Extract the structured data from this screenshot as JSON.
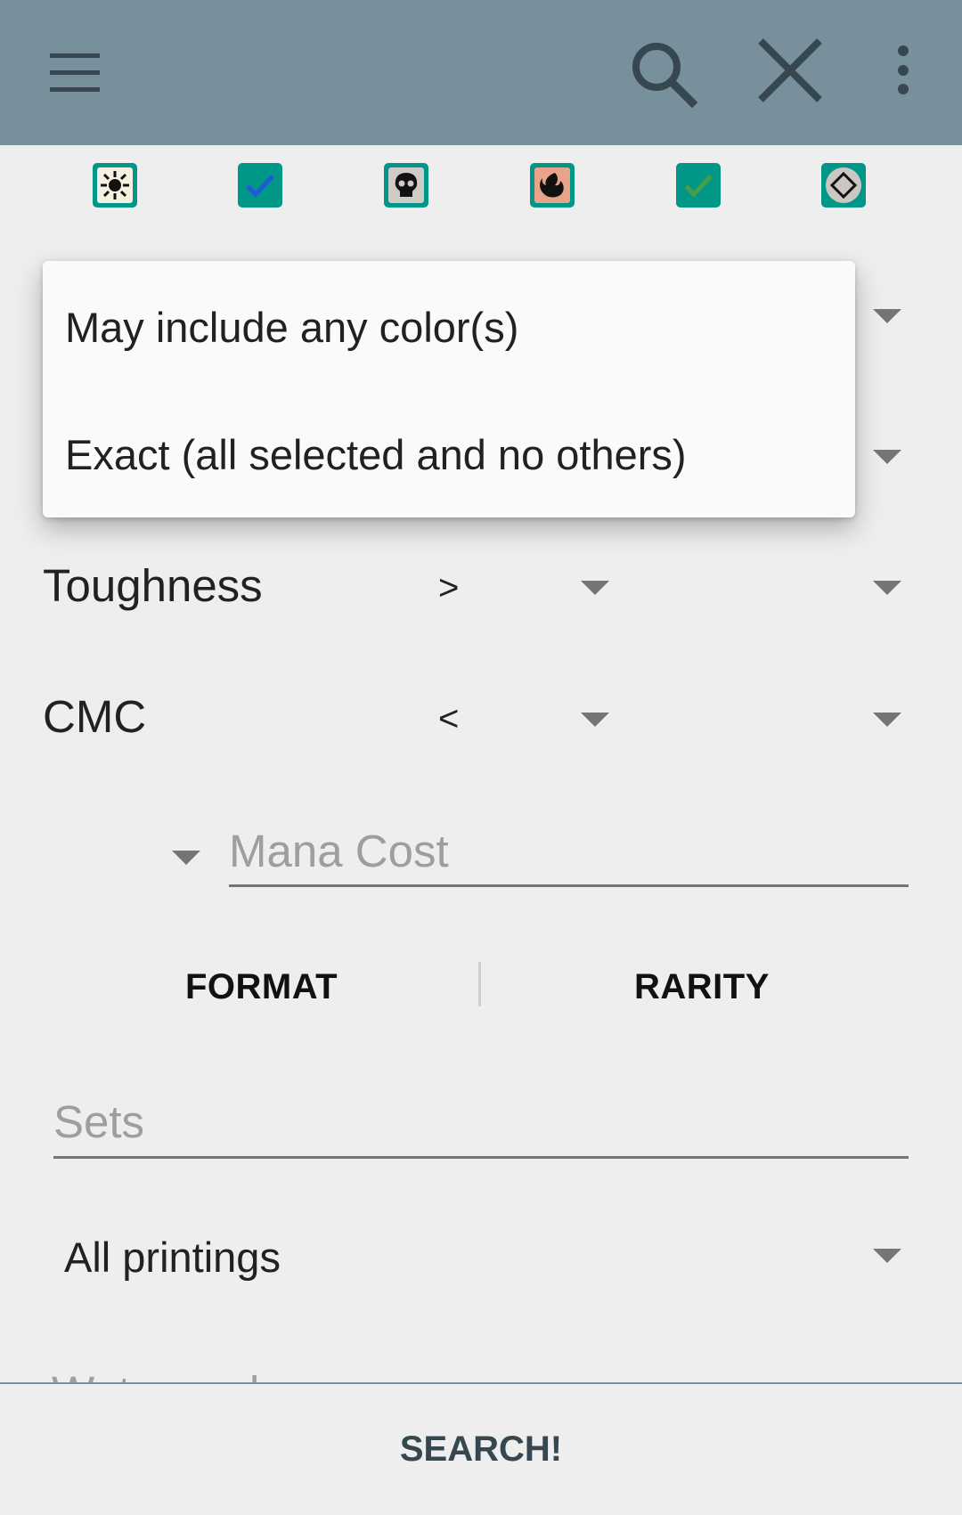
{
  "app_bar": {
    "background": "#78909c",
    "icons": [
      "menu-icon",
      "search-icon",
      "close-icon",
      "more-vert-icon"
    ]
  },
  "color_filters": [
    {
      "name": "white",
      "state": "unchecked",
      "icon": "sun-symbol-icon"
    },
    {
      "name": "blue",
      "state": "checked",
      "icon": "check-icon"
    },
    {
      "name": "black",
      "state": "unchecked",
      "icon": "skull-symbol-icon"
    },
    {
      "name": "red",
      "state": "unchecked",
      "icon": "fire-symbol-icon"
    },
    {
      "name": "green",
      "state": "checked",
      "icon": "check-icon"
    },
    {
      "name": "colorless",
      "state": "unchecked",
      "icon": "diamond-symbol-icon"
    }
  ],
  "color_mode_menu": {
    "options": [
      "May include any color(s)",
      "Exact (all selected and no others)"
    ]
  },
  "filters": {
    "toughness": {
      "label": "Toughness",
      "operator": ">"
    },
    "cmc": {
      "label": "CMC",
      "operator": "<"
    }
  },
  "mana_cost": {
    "placeholder": "Mana Cost"
  },
  "tabs": {
    "format": "FORMAT",
    "rarity": "RARITY"
  },
  "sets": {
    "placeholder": "Sets"
  },
  "printings": {
    "selected": "All printings"
  },
  "watermark": {
    "placeholder": "Watermark"
  },
  "search_button": {
    "label": "SEARCH!"
  },
  "colors": {
    "accent": "#009688",
    "toolbar": "#78909c",
    "icon": "#37474f"
  }
}
